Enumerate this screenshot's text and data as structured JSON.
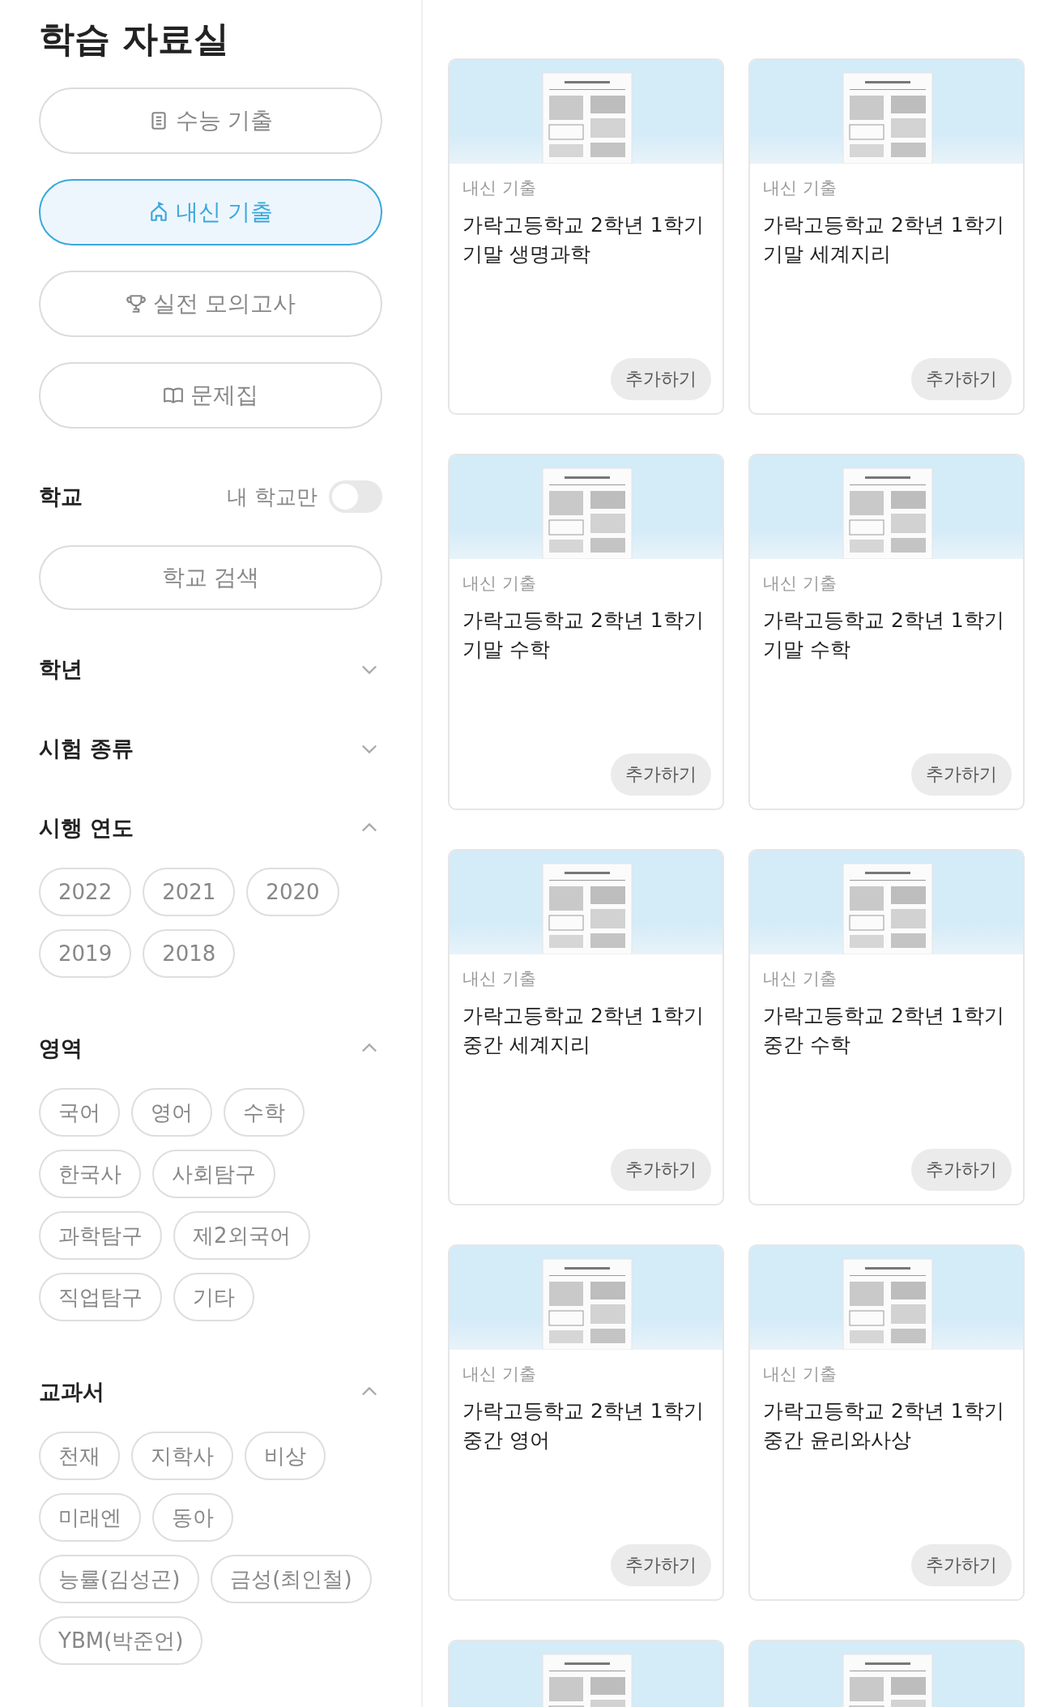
{
  "sidebar": {
    "title": "학습 자료실",
    "nav_items": [
      {
        "label": "수능 기출",
        "selected": false
      },
      {
        "label": "내신 기출",
        "selected": true
      },
      {
        "label": "실전 모의고사",
        "selected": false
      },
      {
        "label": "문제집",
        "selected": false
      }
    ],
    "school": {
      "label": "학교",
      "toggle_label": "내 학교만",
      "toggle_on": false,
      "search_button": "학교 검색"
    },
    "filters": [
      {
        "label": "학년",
        "expanded": false
      },
      {
        "label": "시험 종류",
        "expanded": false
      },
      {
        "label": "시행 연도",
        "expanded": true,
        "chips": [
          "2022",
          "2021",
          "2020",
          "2019",
          "2018"
        ]
      },
      {
        "label": "영역",
        "expanded": true,
        "chips": [
          "국어",
          "영어",
          "수학",
          "한국사",
          "사회탐구",
          "과학탐구",
          "제2외국어",
          "직업탐구",
          "기타"
        ]
      },
      {
        "label": "교과서",
        "expanded": true,
        "chips": [
          "천재",
          "지학사",
          "비상",
          "미래엔",
          "동아",
          "능률(김성곤)",
          "금성(최인철)",
          "YBM(박준언)"
        ]
      }
    ]
  },
  "cards": [
    {
      "category": "내신 기출",
      "title": "가락고등학교 2학년 1학기\n기말 생명과학",
      "button": "추가하기"
    },
    {
      "category": "내신 기출",
      "title": "가락고등학교 2학년 1학기\n기말 세계지리",
      "button": "추가하기"
    },
    {
      "category": "내신 기출",
      "title": "가락고등학교 2학년 1학기\n기말 수학",
      "button": "추가하기"
    },
    {
      "category": "내신 기출",
      "title": "가락고등학교 2학년 1학기\n기말 수학",
      "button": "추가하기"
    },
    {
      "category": "내신 기출",
      "title": "가락고등학교 2학년 1학기\n중간 세계지리",
      "button": "추가하기"
    },
    {
      "category": "내신 기출",
      "title": "가락고등학교 2학년 1학기\n중간 수학",
      "button": "추가하기"
    },
    {
      "category": "내신 기출",
      "title": "가락고등학교 2학년 1학기\n중간 영어",
      "button": "추가하기"
    },
    {
      "category": "내신 기출",
      "title": "가락고등학교 2학년 1학기\n중간 윤리와사상",
      "button": "추가하기"
    },
    {
      "kind": "picture"
    },
    {
      "kind": "picture"
    }
  ]
}
